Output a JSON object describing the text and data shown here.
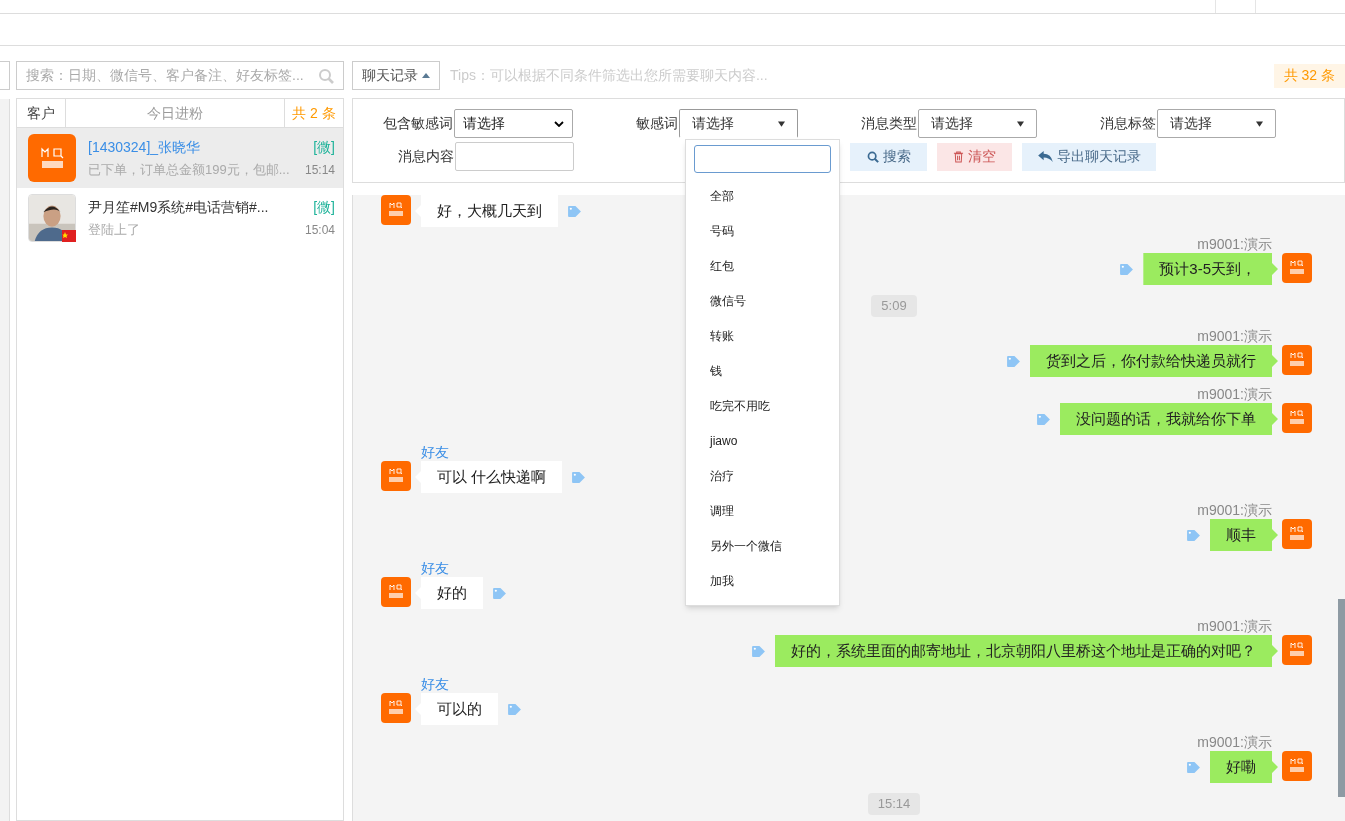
{
  "customer_panel": {
    "search": {
      "placeholder": "搜索：日期、微信号、客户备注、好友标签..."
    },
    "tabs": [
      {
        "label": "客户",
        "selected": false
      },
      {
        "label": "今日进粉",
        "selected": false
      }
    ],
    "count": "共 2 条",
    "customers": [
      {
        "kind": "logo",
        "name": "[1430324]_张晓华",
        "source": "[微]",
        "preview": "已下单，订单总金额199元，包邮...",
        "time": "15:14",
        "selected": true,
        "flag": false
      },
      {
        "name": "尹月笙#M9系统#电话营销#...",
        "source": "[微]",
        "preview": "登陆上了",
        "time": "15:04",
        "selected": false,
        "flag": true
      }
    ]
  },
  "chat": {
    "record_button": "聊天记录",
    "tips": "Tips：可以根据不同条件筛选出您所需要聊天内容...",
    "count": "共 32 条",
    "filters": [
      {
        "kind": "native_select",
        "label": "包含敏感词",
        "value": "请选择",
        "open": false
      },
      {
        "kind": "select",
        "label": "敏感词",
        "value": "请选择",
        "open": true
      },
      {
        "kind": "select",
        "label": "消息类型",
        "value": "请选择",
        "open": false
      },
      {
        "kind": "select",
        "label": "消息标签",
        "value": "请选择",
        "open": false
      },
      {
        "kind": "input",
        "label": "消息内容"
      }
    ],
    "buttons": [
      {
        "kind": "search",
        "label": "搜索"
      },
      {
        "kind": "clear",
        "label": "清空"
      },
      {
        "kind": "export",
        "label": "导出聊天记录"
      }
    ],
    "dropdown_options": [
      "全部",
      "号码",
      "红包",
      "微信号",
      "转账",
      "钱",
      "吃完不用吃",
      "jiawo",
      "治疗",
      "调理",
      "另外一个微信",
      "加我"
    ],
    "messages": [
      {
        "kind": "received",
        "text": "好，大概几天到"
      },
      {
        "kind": "sent",
        "sender": "m9001:演示",
        "text": "预计3-5天到，"
      },
      {
        "kind": "time",
        "text": "5:09"
      },
      {
        "kind": "sent",
        "sender": "m9001:演示",
        "text": "货到之后，你付款给快递员就行"
      },
      {
        "kind": "sent",
        "sender": "m9001:演示",
        "text": "没问题的话，我就给你下单"
      },
      {
        "kind": "received",
        "sender": "好友",
        "text": "可以 什么快递啊"
      },
      {
        "kind": "sent",
        "sender": "m9001:演示",
        "text": "顺丰"
      },
      {
        "kind": "received",
        "sender": "好友",
        "text": "好的"
      },
      {
        "kind": "sent",
        "sender": "m9001:演示",
        "text": "好的，系统里面的邮寄地址，北京朝阳八里桥这个地址是正确的对吧？"
      },
      {
        "kind": "received",
        "sender": "好友",
        "text": "可以的"
      },
      {
        "kind": "sent",
        "sender": "m9001:演示",
        "text": "好嘞"
      },
      {
        "kind": "time",
        "text": "15:14"
      }
    ]
  }
}
